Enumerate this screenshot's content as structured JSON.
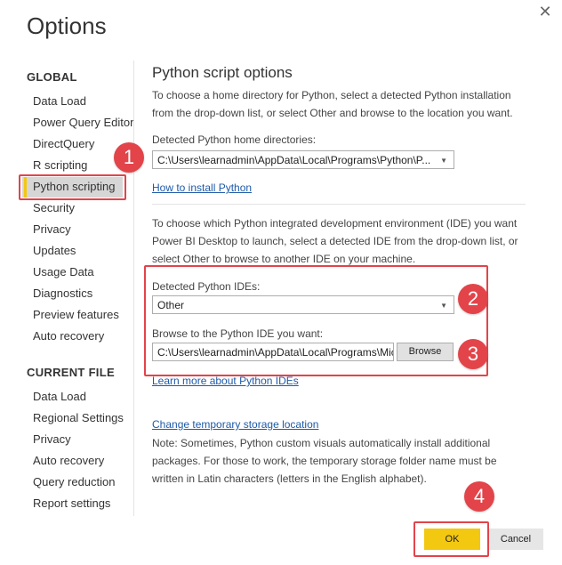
{
  "dialog": {
    "title": "Options",
    "close_glyph": "✕"
  },
  "sidebar": {
    "global_header": "GLOBAL",
    "global_items": [
      "Data Load",
      "Power Query Editor",
      "DirectQuery",
      "R scripting",
      "Python scripting",
      "Security",
      "Privacy",
      "Updates",
      "Usage Data",
      "Diagnostics",
      "Preview features",
      "Auto recovery"
    ],
    "selected": "Python scripting",
    "current_header": "CURRENT FILE",
    "current_items": [
      "Data Load",
      "Regional Settings",
      "Privacy",
      "Auto recovery",
      "Query reduction",
      "Report settings"
    ]
  },
  "main": {
    "heading": "Python script options",
    "intro": "To choose a home directory for Python, select a detected Python installation from the drop-down list, or select Other and browse to the location you want.",
    "home_label": "Detected Python home directories:",
    "home_value": "C:\\Users\\learnadmin\\AppData\\Local\\Programs\\Python\\P...",
    "install_link": "How to install Python",
    "ide_intro": "To choose which Python integrated development environment (IDE) you want Power BI Desktop to launch, select a detected IDE from the drop-down list, or select Other to browse to another IDE on your machine.",
    "ide_label": "Detected Python IDEs:",
    "ide_value": "Other",
    "browse_label": "Browse to the Python IDE you want:",
    "browse_value": "C:\\Users\\learnadmin\\AppData\\Local\\Programs\\Mic",
    "browse_button": "Browse",
    "learn_link": "Learn more about Python IDEs",
    "storage_link": "Change temporary storage location",
    "note": "Note: Sometimes, Python custom visuals automatically install additional packages. For those to work, the temporary storage folder name must be written in Latin characters (letters in the English alphabet)."
  },
  "footer": {
    "ok": "OK",
    "cancel": "Cancel"
  },
  "callouts": [
    "1",
    "2",
    "3",
    "4"
  ],
  "colors": {
    "accent": "#f2c811",
    "callout": "#e2444a",
    "link": "#1e5aa8"
  }
}
